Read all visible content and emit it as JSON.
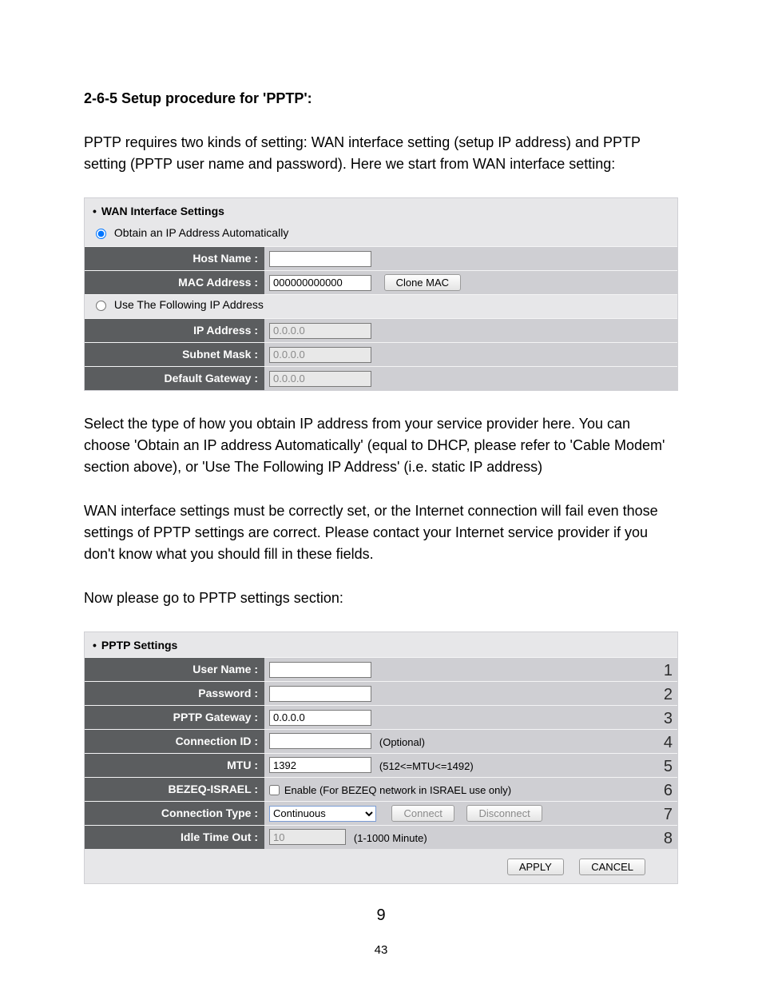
{
  "heading": "2-6-5 Setup procedure for 'PPTP':",
  "para1": "PPTP requires two kinds of setting: WAN interface setting (setup IP address) and PPTP setting (PPTP user name and password). Here we start from WAN interface setting:",
  "wan": {
    "title": "WAN Interface Settings",
    "radio_auto": "Obtain an IP Address Automatically",
    "radio_static": "Use The Following IP Address",
    "host_label": "Host Name :",
    "host_value": "",
    "mac_label": "MAC Address :",
    "mac_value": "000000000000",
    "clone_btn": "Clone MAC",
    "ip_label": "IP Address :",
    "ip_value": "0.0.0.0",
    "subnet_label": "Subnet Mask :",
    "subnet_value": "0.0.0.0",
    "gateway_label": "Default Gateway :",
    "gateway_value": "0.0.0.0"
  },
  "para2": "Select the type of how you obtain IP address from your service provider here. You can choose 'Obtain an IP address Automatically' (equal to DHCP, please refer to 'Cable Modem' section above), or 'Use The Following IP Address' (i.e. static IP address)",
  "para3": "WAN interface settings must be correctly set, or the Internet connection will fail even those settings of PPTP settings are correct. Please contact your Internet service provider if you don't know what you should fill in these fields.",
  "para4": "Now please go to PPTP settings section:",
  "pptp": {
    "title": "PPTP Settings",
    "user_label": "User Name :",
    "user_value": "",
    "pass_label": "Password :",
    "pass_value": "",
    "gw_label": "PPTP Gateway :",
    "gw_value": "0.0.0.0",
    "conn_label": "Connection ID :",
    "conn_value": "",
    "conn_hint": "(Optional)",
    "mtu_label": "MTU :",
    "mtu_value": "1392",
    "mtu_hint": "(512<=MTU<=1492)",
    "bezeq_label": "BEZEQ-ISRAEL :",
    "bezeq_hint": "Enable (For BEZEQ network in ISRAEL use only)",
    "ctype_label": "Connection Type :",
    "ctype_value": "Continuous",
    "connect_btn": "Connect",
    "disconnect_btn": "Disconnect",
    "idle_label": "Idle Time Out :",
    "idle_value": "10",
    "idle_hint": "(1-1000 Minute)",
    "apply_btn": "APPLY",
    "cancel_btn": "CANCEL"
  },
  "callouts": {
    "c1": "1",
    "c2": "2",
    "c3": "3",
    "c4": "4",
    "c5": "5",
    "c6": "6",
    "c7": "7",
    "c8": "8",
    "c9": "9"
  },
  "page_number": "43"
}
